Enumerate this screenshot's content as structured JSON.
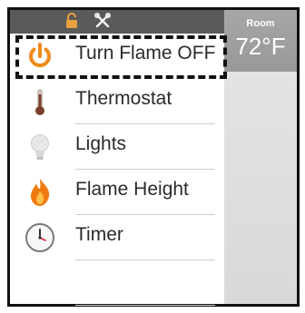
{
  "top_bar": {
    "icons": [
      "unlocked-padlock-icon",
      "wrench-tools-icon"
    ]
  },
  "menu": {
    "items": [
      {
        "label": "Turn Flame OFF",
        "icon": "power-icon"
      },
      {
        "label": "Thermostat",
        "icon": "thermometer-icon"
      },
      {
        "label": "Lights",
        "icon": "light-bulb-icon"
      },
      {
        "label": "Flame Height",
        "icon": "flame-icon"
      },
      {
        "label": "Timer",
        "icon": "clock-icon"
      }
    ]
  },
  "room": {
    "label": "Room",
    "temperature": "72°F"
  },
  "colors": {
    "accent_orange": "#f08a1a",
    "top_strip": "#5a5a5a",
    "room_box": "#a0a0a0",
    "side_panel": "#e0e0e0"
  }
}
